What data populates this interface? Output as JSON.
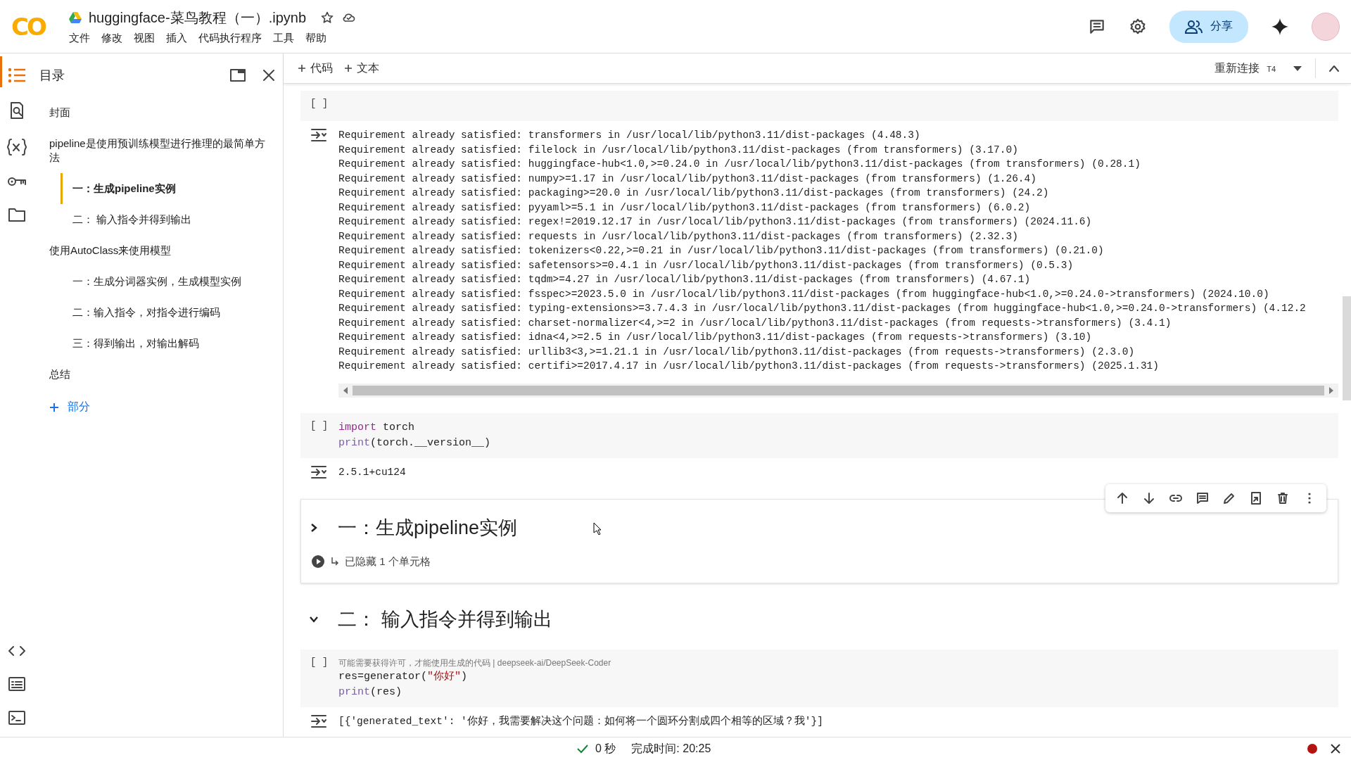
{
  "header": {
    "logo": "CO",
    "title": "huggingface-菜鸟教程（一）.ipynb",
    "menu": [
      "文件",
      "修改",
      "视图",
      "插入",
      "代码执行程序",
      "工具",
      "帮助"
    ],
    "share": "分享"
  },
  "toolbar": {
    "add_buttons": [
      "代码",
      "文本"
    ],
    "runtime": "重新连接",
    "accelerator": "T4"
  },
  "sidebar": {
    "title": "目录",
    "items": [
      {
        "label": "封面",
        "selected": false
      },
      {
        "label": "pipeline是使用预训练模型进行推理的最简单方法",
        "selected": false,
        "children": [
          {
            "label": "一：生成pipeline实例",
            "selected": true
          },
          {
            "label": "二： 输入指令并得到输出",
            "selected": false
          }
        ]
      },
      {
        "label": "使用AutoClass来使用模型",
        "selected": false,
        "children": [
          {
            "label": "一：生成分词器实例，生成模型实例",
            "selected": false
          },
          {
            "label": "二：输入指令，对指令进行编码",
            "selected": false
          },
          {
            "label": "三：得到输出，对输出解码",
            "selected": false
          }
        ]
      },
      {
        "label": "总结",
        "selected": false
      }
    ],
    "add_section": "部分"
  },
  "cells": [
    {
      "kind": "code",
      "prompt": "[ ]",
      "output": [
        "Requirement already satisfied: transformers in /usr/local/lib/python3.11/dist-packages (4.48.3)",
        "Requirement already satisfied: filelock in /usr/local/lib/python3.11/dist-packages (from transformers) (3.17.0)",
        "Requirement already satisfied: huggingface-hub<1.0,>=0.24.0 in /usr/local/lib/python3.11/dist-packages (from transformers) (0.28.1)",
        "Requirement already satisfied: numpy>=1.17 in /usr/local/lib/python3.11/dist-packages (from transformers) (1.26.4)",
        "Requirement already satisfied: packaging>=20.0 in /usr/local/lib/python3.11/dist-packages (from transformers) (24.2)",
        "Requirement already satisfied: pyyaml>=5.1 in /usr/local/lib/python3.11/dist-packages (from transformers) (6.0.2)",
        "Requirement already satisfied: regex!=2019.12.17 in /usr/local/lib/python3.11/dist-packages (from transformers) (2024.11.6)",
        "Requirement already satisfied: requests in /usr/local/lib/python3.11/dist-packages (from transformers) (2.32.3)",
        "Requirement already satisfied: tokenizers<0.22,>=0.21 in /usr/local/lib/python3.11/dist-packages (from transformers) (0.21.0)",
        "Requirement already satisfied: safetensors>=0.4.1 in /usr/local/lib/python3.11/dist-packages (from transformers) (0.5.3)",
        "Requirement already satisfied: tqdm>=4.27 in /usr/local/lib/python3.11/dist-packages (from transformers) (4.67.1)",
        "Requirement already satisfied: fsspec>=2023.5.0 in /usr/local/lib/python3.11/dist-packages (from huggingface-hub<1.0,>=0.24.0->transformers) (2024.10.0)",
        "Requirement already satisfied: typing-extensions>=3.7.4.3 in /usr/local/lib/python3.11/dist-packages (from huggingface-hub<1.0,>=0.24.0->transformers) (4.12.2",
        "Requirement already satisfied: charset-normalizer<4,>=2 in /usr/local/lib/python3.11/dist-packages (from requests->transformers) (3.4.1)",
        "Requirement already satisfied: idna<4,>=2.5 in /usr/local/lib/python3.11/dist-packages (from requests->transformers) (3.10)",
        "Requirement already satisfied: urllib3<3,>=1.21.1 in /usr/local/lib/python3.11/dist-packages (from requests->transformers) (2.3.0)",
        "Requirement already satisfied: certifi>=2017.4.17 in /usr/local/lib/python3.11/dist-packages (from requests->transformers) (2025.1.31)"
      ]
    },
    {
      "kind": "code",
      "prompt": "[ ]",
      "lines": [
        [
          {
            "text": "import",
            "kind": "keyword"
          },
          {
            "text": "  torch",
            "kind": "plain"
          }
        ],
        [
          {
            "text": "print",
            "kind": "builtin"
          },
          {
            "text": "(torch.__version__)",
            "kind": "plain"
          }
        ]
      ],
      "output": [
        "2.5.1+cu124"
      ]
    },
    {
      "kind": "section",
      "heading": "一：生成pipeline实例",
      "expanded": false,
      "focused": true,
      "hidden_note": "已隐藏 1 个单元格"
    },
    {
      "kind": "section",
      "heading": "二： 输入指令并得到输出",
      "expanded": true,
      "focused": false
    },
    {
      "kind": "code",
      "prompt": "[ ]",
      "hint": "可能需要获得许可，才能使用生成的代码 | deepseek-ai/DeepSeek-Coder",
      "lines": [
        [
          {
            "text": "res=generator(",
            "kind": "plain"
          },
          {
            "text": "\"你好\"",
            "kind": "string"
          },
          {
            "text": ")",
            "kind": "plain"
          }
        ],
        [
          {
            "text": "print",
            "kind": "builtin"
          },
          {
            "text": "(res)",
            "kind": "plain"
          }
        ]
      ],
      "output": [
        "[{'generated_text': '你好，我需要解决这个问题：如何将一个圆环分割成四个相等的区域？我'}]"
      ]
    }
  ],
  "status_bar": {
    "ok": true,
    "duration": "0 秒",
    "finished": "完成时间: 20:25"
  }
}
